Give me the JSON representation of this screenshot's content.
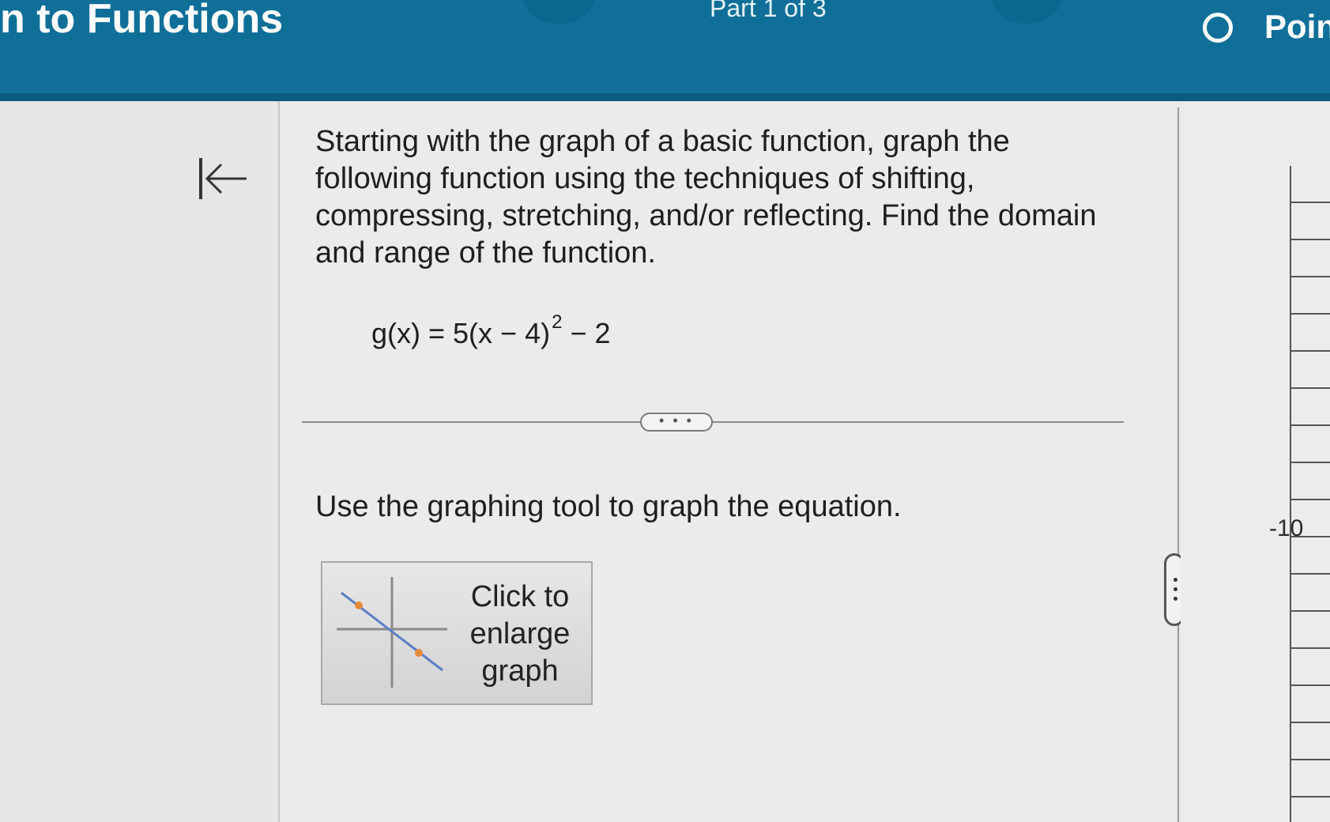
{
  "header": {
    "course_title": "n to Functions",
    "part_label": "Part 1 of 3",
    "points_label": "Poin"
  },
  "question": {
    "prompt": "Starting with the graph of a basic function, graph the following function using the techniques of shifting, compressing, stretching, and/or reflecting. Find the domain and range of the function.",
    "equation_lhs": "g(x) = 5(x − 4)",
    "equation_exponent": "2",
    "equation_rhs": " − 2",
    "expand_label": "• • •",
    "instruction": "Use the graphing tool to graph the equation.",
    "enlarge_button_label": "Click to\nenlarge\ngraph"
  },
  "graph_panel": {
    "tick_label": "-10"
  },
  "icons": {
    "collapse": "collapse-left-icon",
    "graph_thumbnail": "graph-thumbnail-icon",
    "splitter": "drag-handle-icon"
  },
  "colors": {
    "header_bg": "#0f6f99",
    "thumbnail_point": "#e8893a",
    "thumbnail_line": "#5b7fc4"
  }
}
